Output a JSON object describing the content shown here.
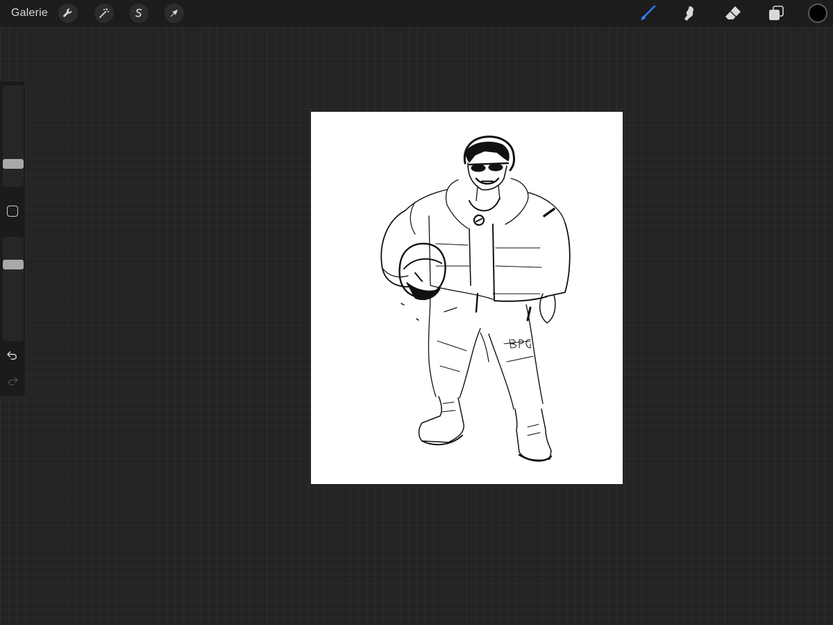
{
  "topbar": {
    "gallery_label": "Galerie",
    "left_tools": [
      {
        "name": "actions",
        "icon": "wrench-icon"
      },
      {
        "name": "adjustments",
        "icon": "magic-wand-icon"
      },
      {
        "name": "selection",
        "icon": "selection-s-icon"
      },
      {
        "name": "transform",
        "icon": "arrow-cursor-icon"
      }
    ],
    "right_tools": [
      {
        "name": "brush",
        "icon": "brush-icon",
        "active": true
      },
      {
        "name": "smudge",
        "icon": "smudge-icon",
        "active": false
      },
      {
        "name": "eraser",
        "icon": "eraser-icon",
        "active": false
      },
      {
        "name": "layers",
        "icon": "layers-icon",
        "active": false
      }
    ],
    "current_color": "#000000"
  },
  "sidebar": {
    "brush_size_slider": {
      "icon": "slider-thumb"
    },
    "modifier_button": {
      "icon": "square-icon"
    },
    "opacity_slider": {
      "icon": "slider-thumb"
    },
    "undo": {
      "icon": "undo-icon",
      "enabled": true
    },
    "redo": {
      "icon": "redo-icon",
      "enabled": false
    }
  },
  "colors": {
    "background": "#242424",
    "topbar": "#1c1c1c",
    "active_tool": "#2d7df6",
    "icon": "#d9d9d9",
    "canvas": "#ffffff"
  },
  "canvas": {
    "content": "sketch-of-character-in-puffer-jacket-holding-helmet",
    "signature": "BPG"
  }
}
